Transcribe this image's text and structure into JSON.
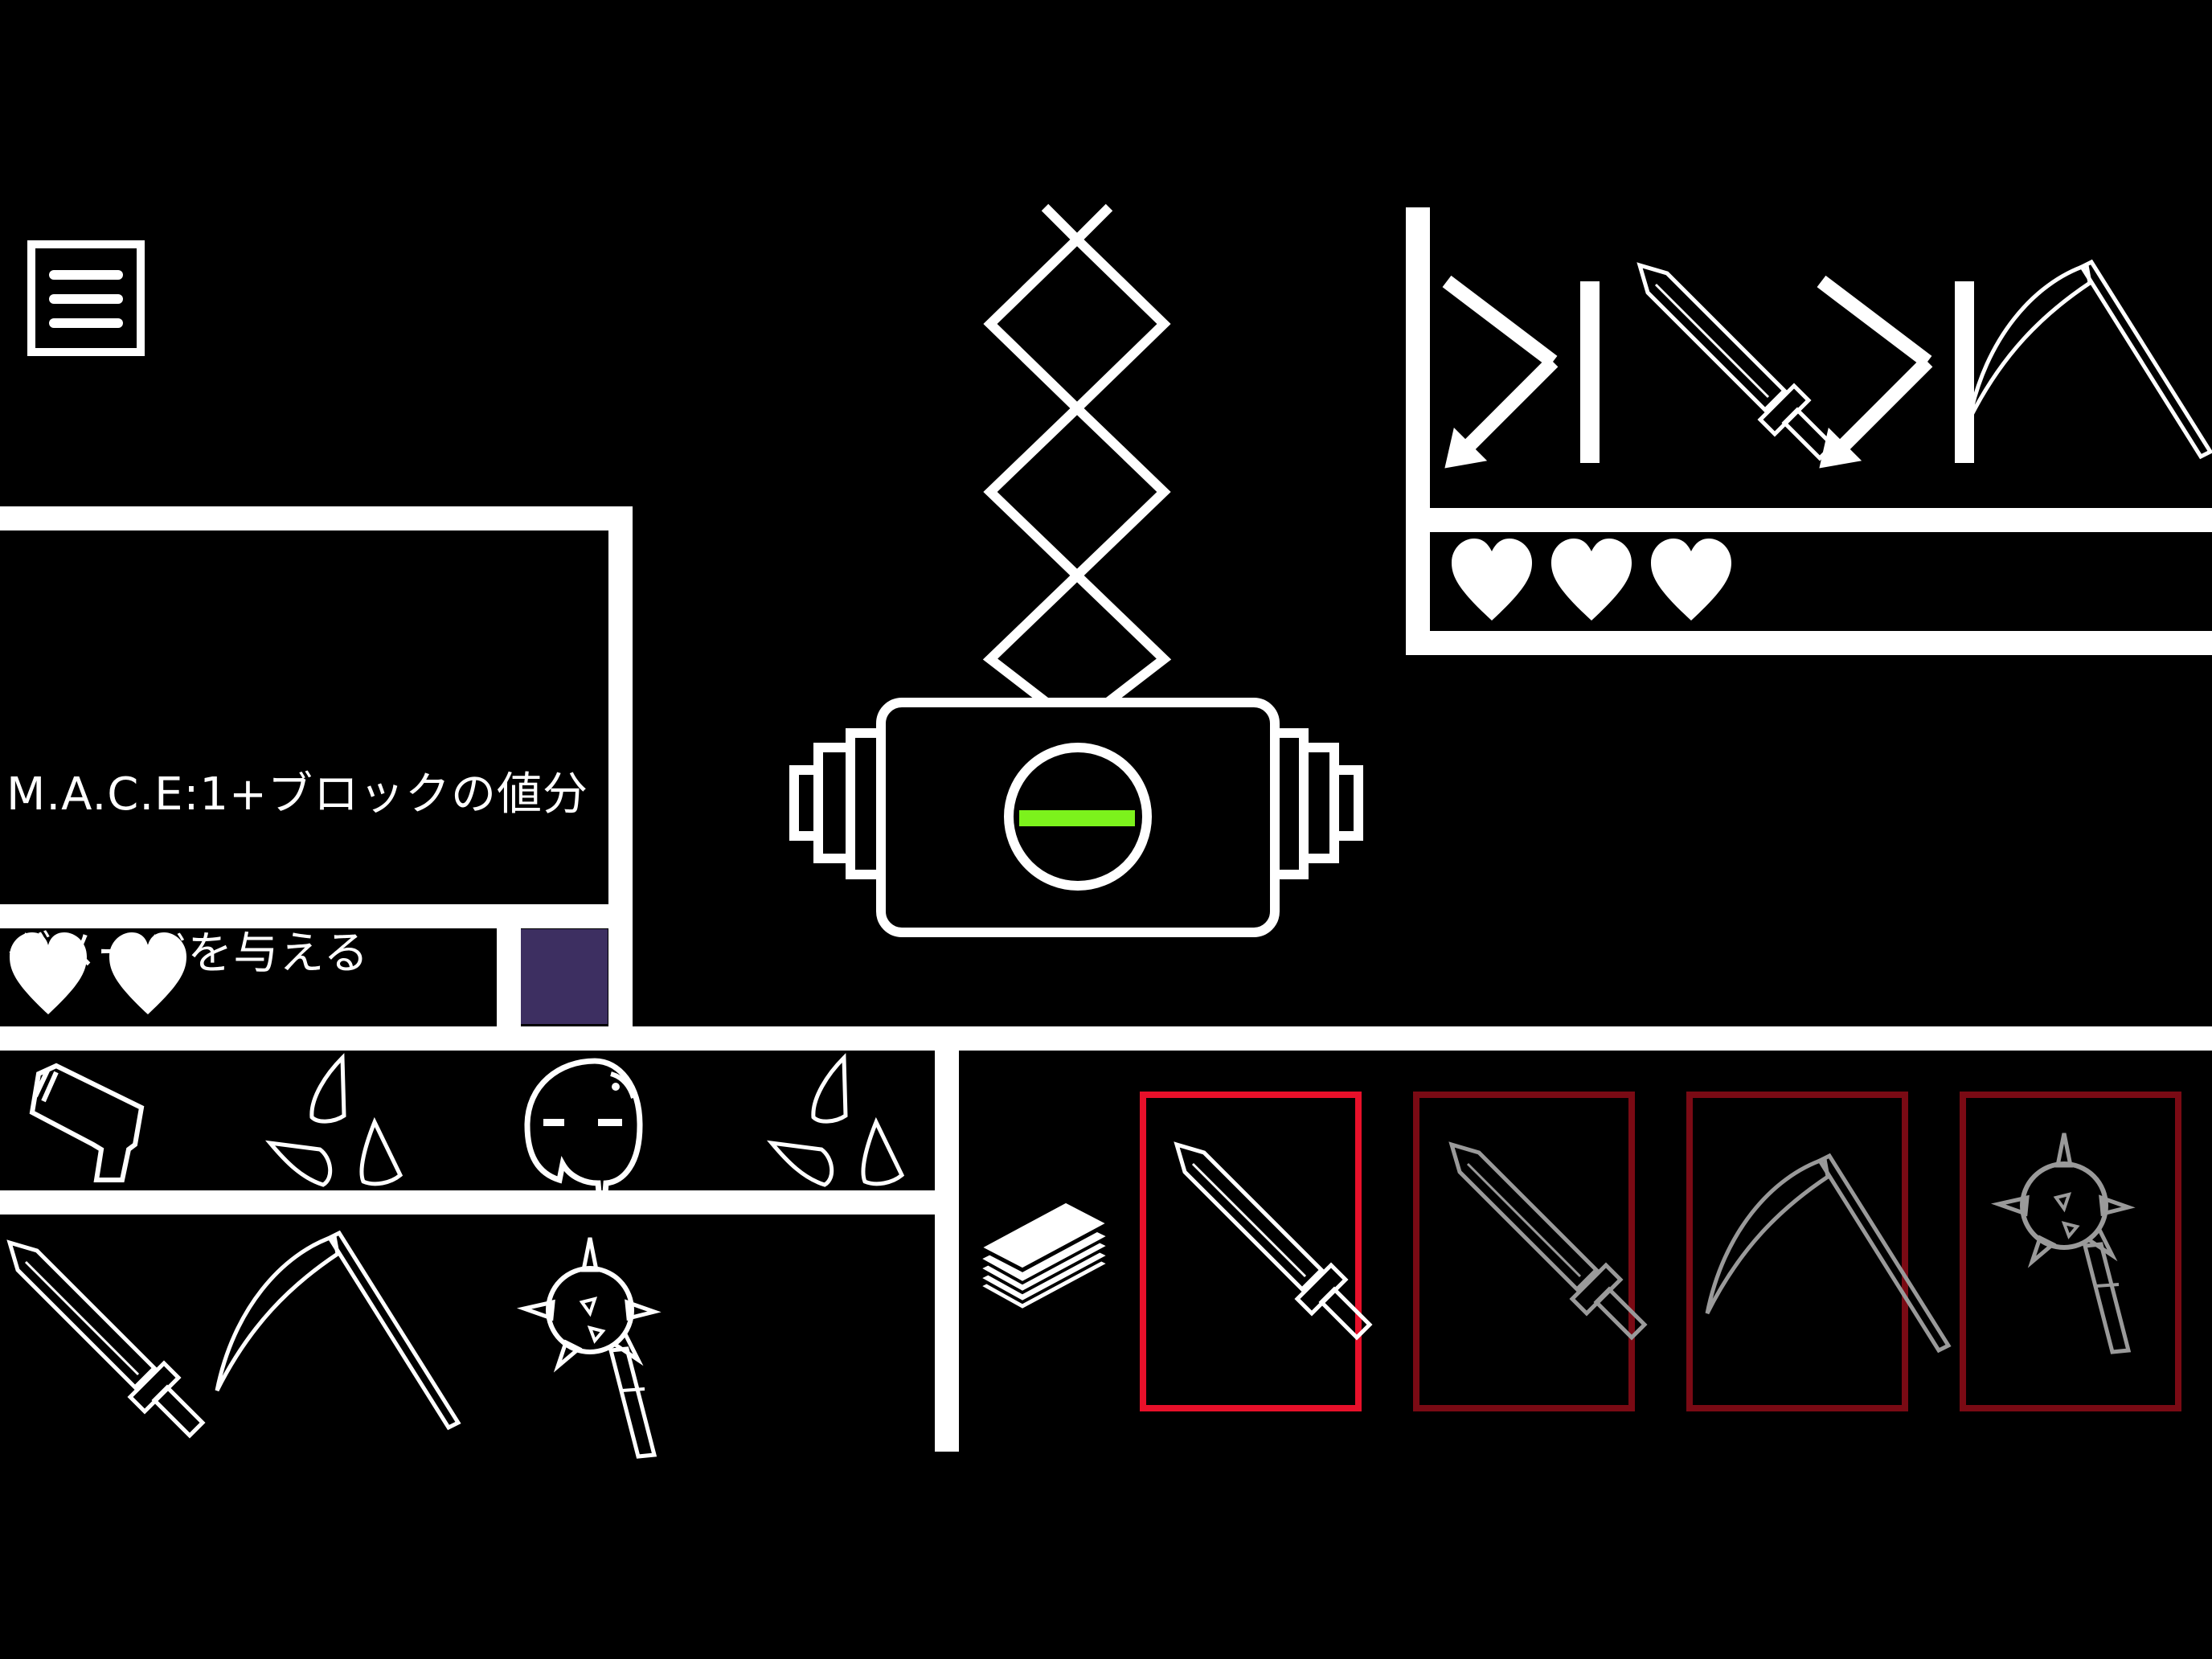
{
  "menu": {
    "icon": "hamburger-menu-icon"
  },
  "card_info": {
    "line1": "M.A.C.E:1+ブロックの値分",
    "line2": "ダメージを与える"
  },
  "player": {
    "lives": 2,
    "block_color": "#3d2f61"
  },
  "enemy": {
    "lives": 3,
    "intent_icons": [
      "drop-arrow-icon",
      "sword-icon",
      "drop-arrow-icon",
      "scythe-icon"
    ]
  },
  "machine": {
    "indicator_color": "#7cf21c",
    "indicator_icon": "minus-icon"
  },
  "inventory": {
    "row1": [
      "pistol-icon",
      "spikes-icon",
      "skull-icon",
      "spikes-icon"
    ],
    "row2": [
      "sword-icon",
      "scythe-icon",
      "mace-icon"
    ]
  },
  "deck": {
    "icon": "card-stack-icon"
  },
  "hand": [
    {
      "icon": "sword-icon",
      "selected": true
    },
    {
      "icon": "sword-icon",
      "selected": false
    },
    {
      "icon": "scythe-icon",
      "selected": false
    },
    {
      "icon": "mace-icon",
      "selected": false
    }
  ],
  "colors": {
    "line": "#ffffff",
    "selected_frame": "#e8102a",
    "unselected_frame": "#7a0a14",
    "disabled_icon": "#9a9a9a"
  }
}
